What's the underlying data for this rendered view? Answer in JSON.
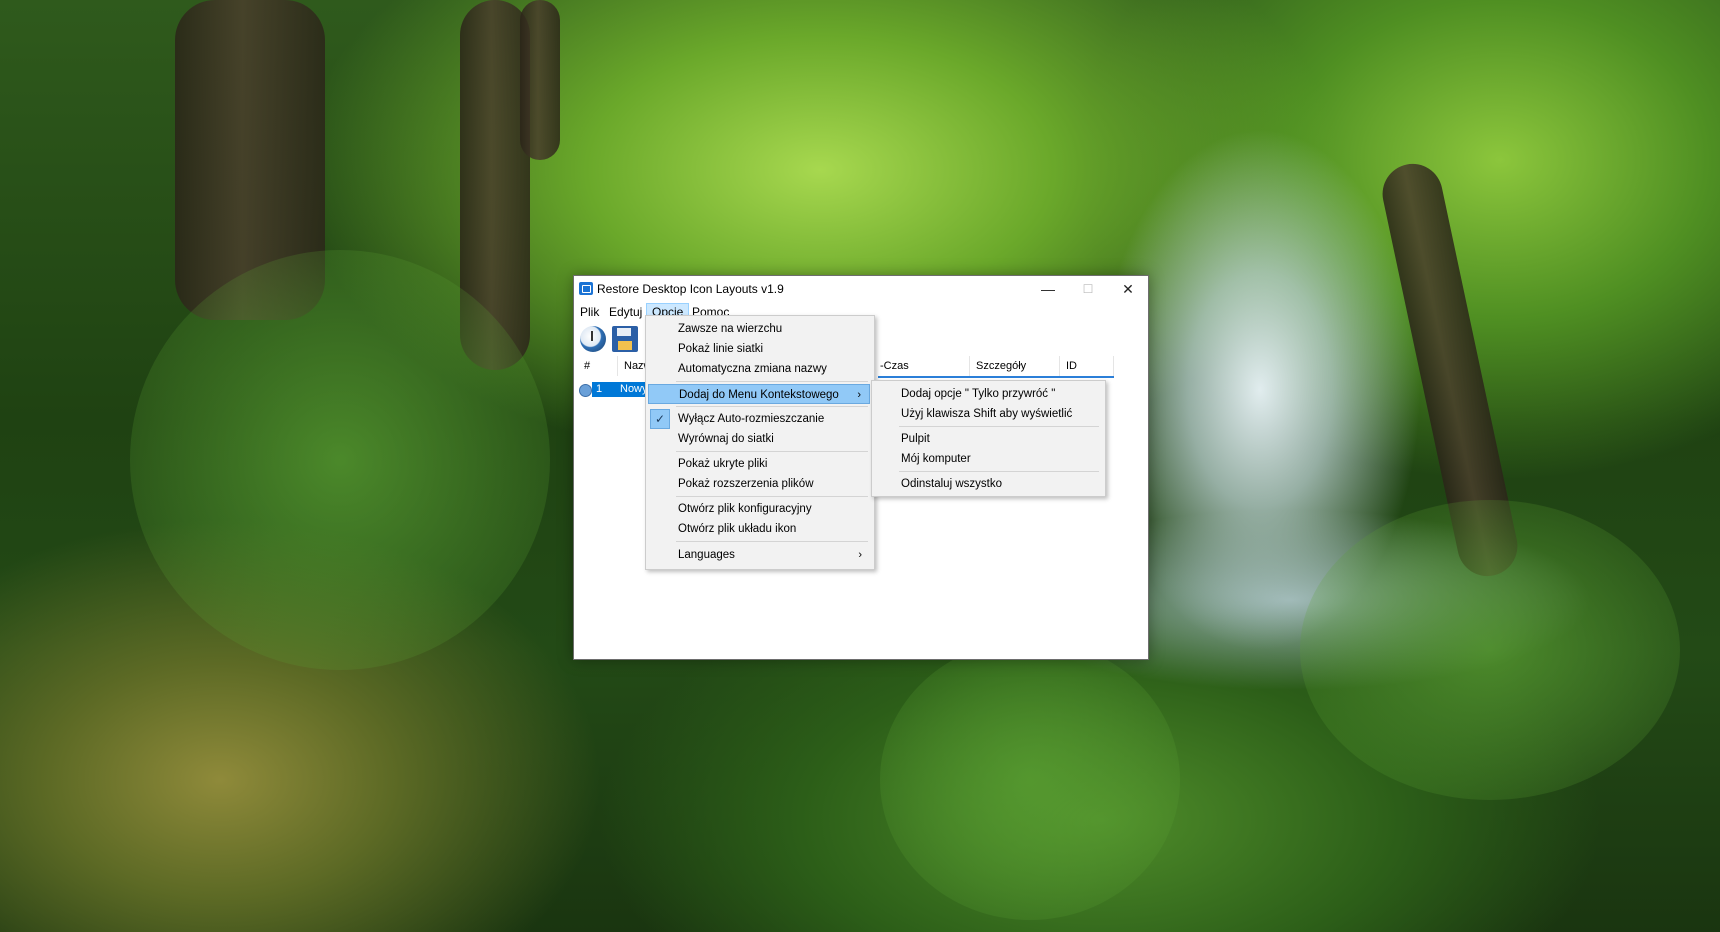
{
  "window": {
    "title": "Restore Desktop Icon Layouts v1.9",
    "controls": {
      "minimize": "—",
      "maximize": "☐",
      "close": "✕"
    }
  },
  "menubar": {
    "items": [
      {
        "label": "Plik"
      },
      {
        "label": "Edytuj"
      },
      {
        "label": "Opcje"
      },
      {
        "label": "Pomoc"
      }
    ],
    "active": "Opcje"
  },
  "toolbar": {
    "buttons": [
      {
        "icon": "restore-icon"
      },
      {
        "icon": "save-icon"
      }
    ]
  },
  "list": {
    "columns": [
      {
        "label": "#"
      },
      {
        "label": "Nazw"
      },
      {
        "label": "-Czas"
      },
      {
        "label": "Szczegóły"
      },
      {
        "label": "ID"
      }
    ],
    "rows": [
      {
        "num": "1",
        "name": "Nowy"
      }
    ]
  },
  "options_menu": {
    "items": [
      {
        "label": "Zawsze na wierzchu"
      },
      {
        "label": "Pokaż linie siatki"
      },
      {
        "label": "Automatyczna zmiana nazwy"
      },
      {
        "label": "Dodaj do Menu Kontekstowego",
        "submenu": true,
        "highlighted": true
      },
      {
        "label": "Wyłącz Auto-rozmieszczanie",
        "checked": true
      },
      {
        "label": "Wyrównaj do siatki"
      },
      {
        "label": "Pokaż ukryte pliki"
      },
      {
        "label": "Pokaż rozszerzenia plików"
      },
      {
        "label": "Otwórz plik konfiguracyjny"
      },
      {
        "label": "Otwórz plik układu ikon"
      },
      {
        "label": "Languages",
        "submenu": true
      }
    ],
    "submenu_arrow": "›",
    "check_mark": "✓"
  },
  "context_submenu": {
    "items": [
      {
        "label": "Dodaj opcje \" Tylko przywróć \""
      },
      {
        "label": "Użyj klawisza Shift aby wyświetlić"
      },
      {
        "label": "Pulpit"
      },
      {
        "label": "Mój komputer"
      },
      {
        "label": "Odinstaluj wszystko"
      }
    ]
  },
  "colors": {
    "highlight": "#91c9f7",
    "selection": "#0078d7",
    "menu_bg": "#f2f2f2"
  }
}
